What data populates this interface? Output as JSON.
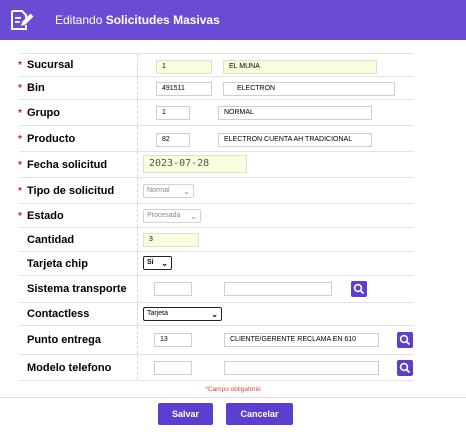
{
  "header": {
    "prefix": "Editando",
    "title": "Solicitudes Masivas"
  },
  "fields": {
    "sucursal": {
      "label": "Sucursal",
      "code": "1",
      "name": "EL MUNA"
    },
    "bin": {
      "label": "Bin",
      "code": "491511",
      "name": "ELECTRON"
    },
    "grupo": {
      "label": "Grupo",
      "code": "1",
      "name": "NORMAL"
    },
    "producto": {
      "label": "Producto",
      "code": "82",
      "name": "ELECTRON CUENTA AH TRADICIONAL"
    },
    "fecha_solicitud": {
      "label": "Fecha solicitud",
      "value": "2023-07-28"
    },
    "tipo_solicitud": {
      "label": "Tipo de solicitud",
      "value": "Normal"
    },
    "estado": {
      "label": "Estado",
      "value": "Procesada"
    },
    "cantidad": {
      "label": "Cantidad",
      "value": "3"
    },
    "tarjeta_chip": {
      "label": "Tarjeta chip",
      "value": "Si"
    },
    "sistema_transporte": {
      "label": "Sistema transporte",
      "code": "",
      "name": ""
    },
    "contactless": {
      "label": "Contactless",
      "value": "Tarjeta"
    },
    "punto_entrega": {
      "label": "Punto entrega",
      "code": "13",
      "name": "CLIENTE/GERENTE RECLAMA EN 610"
    },
    "modelo_telefono": {
      "label": "Modelo telefono",
      "code": "",
      "name": ""
    }
  },
  "required_mark": "*",
  "required_note": "*Campo obligatorio",
  "buttons": {
    "save": "Salvar",
    "cancel": "Cancelar"
  },
  "colors": {
    "header": "#6a4bd4",
    "button": "#5b3fd0",
    "required": "#d9241c",
    "readonly_bg": "#fafcde"
  }
}
